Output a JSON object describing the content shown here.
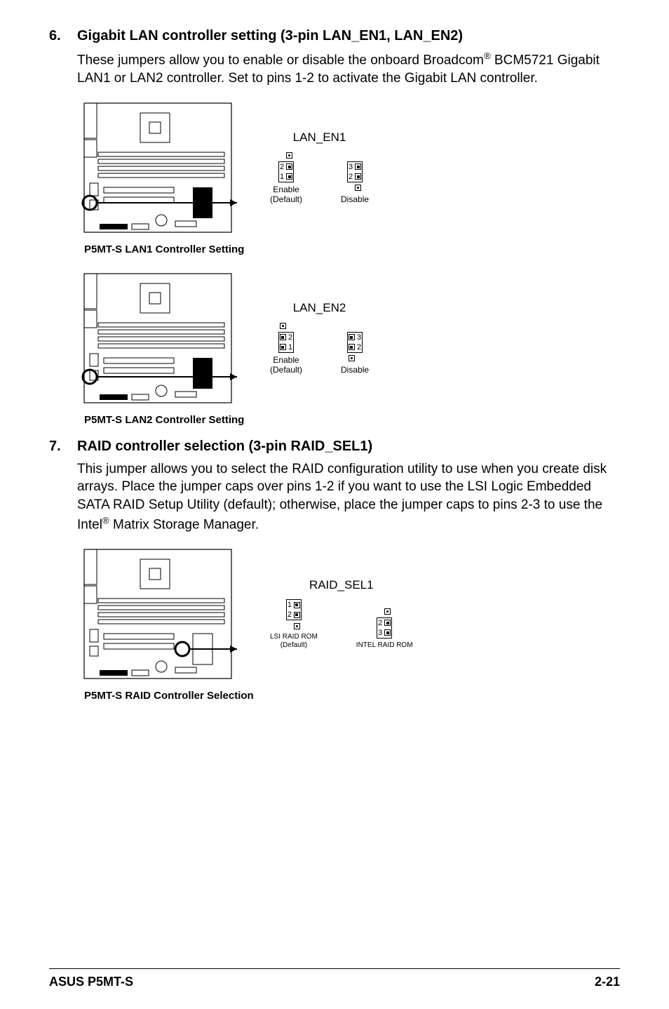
{
  "section6": {
    "num": "6.",
    "title": "Gigabit LAN controller setting (3-pin LAN_EN1, LAN_EN2)",
    "body_pre": "These jumpers allow you to enable or disable the onboard Broadcom",
    "body_post": " BCM5721 Gigabit LAN1 or LAN2 controller. Set to pins 1-2 to activate the Gigabit LAN controller."
  },
  "diag1": {
    "jumper_title": "LAN_EN1",
    "opt_a": {
      "label_line1": "Enable",
      "label_line2": "(Default)",
      "n1": "1",
      "n2": "2"
    },
    "opt_b": {
      "label_line1": "Disable",
      "n2": "2",
      "n3": "3"
    },
    "caption": "P5MT-S LAN1 Controller Setting"
  },
  "diag2": {
    "jumper_title": "LAN_EN2",
    "opt_a": {
      "label_line1": "Enable",
      "label_line2": "(Default)",
      "n1": "1",
      "n2": "2"
    },
    "opt_b": {
      "label_line1": "Disable",
      "n2": "2",
      "n3": "3"
    },
    "caption": "P5MT-S LAN2 Controller Setting"
  },
  "section7": {
    "num": "7.",
    "title": "RAID controller selection (3-pin RAID_SEL1)",
    "body_a": "This jumper allows you to select the RAID configuration utility to use when you create disk arrays. Place the jumper caps over pins 1-2 if you want to use the LSI Logic Embedded SATA RAID Setup Utility (default); otherwise, place the jumper caps to pins 2-3 to use the Intel",
    "body_b": " Matrix Storage Manager."
  },
  "diag3": {
    "jumper_title": "RAID_SEL1",
    "opt_a": {
      "label_line1": "LSI RAID ROM",
      "label_line2": "(Default)",
      "n1": "1",
      "n2": "2"
    },
    "opt_b": {
      "label_line1": "INTEL RAID ROM",
      "n2": "2",
      "n3": "3"
    },
    "caption": "P5MT-S RAID Controller Selection"
  },
  "footer": {
    "left": "ASUS P5MT-S",
    "right": "2-21"
  }
}
